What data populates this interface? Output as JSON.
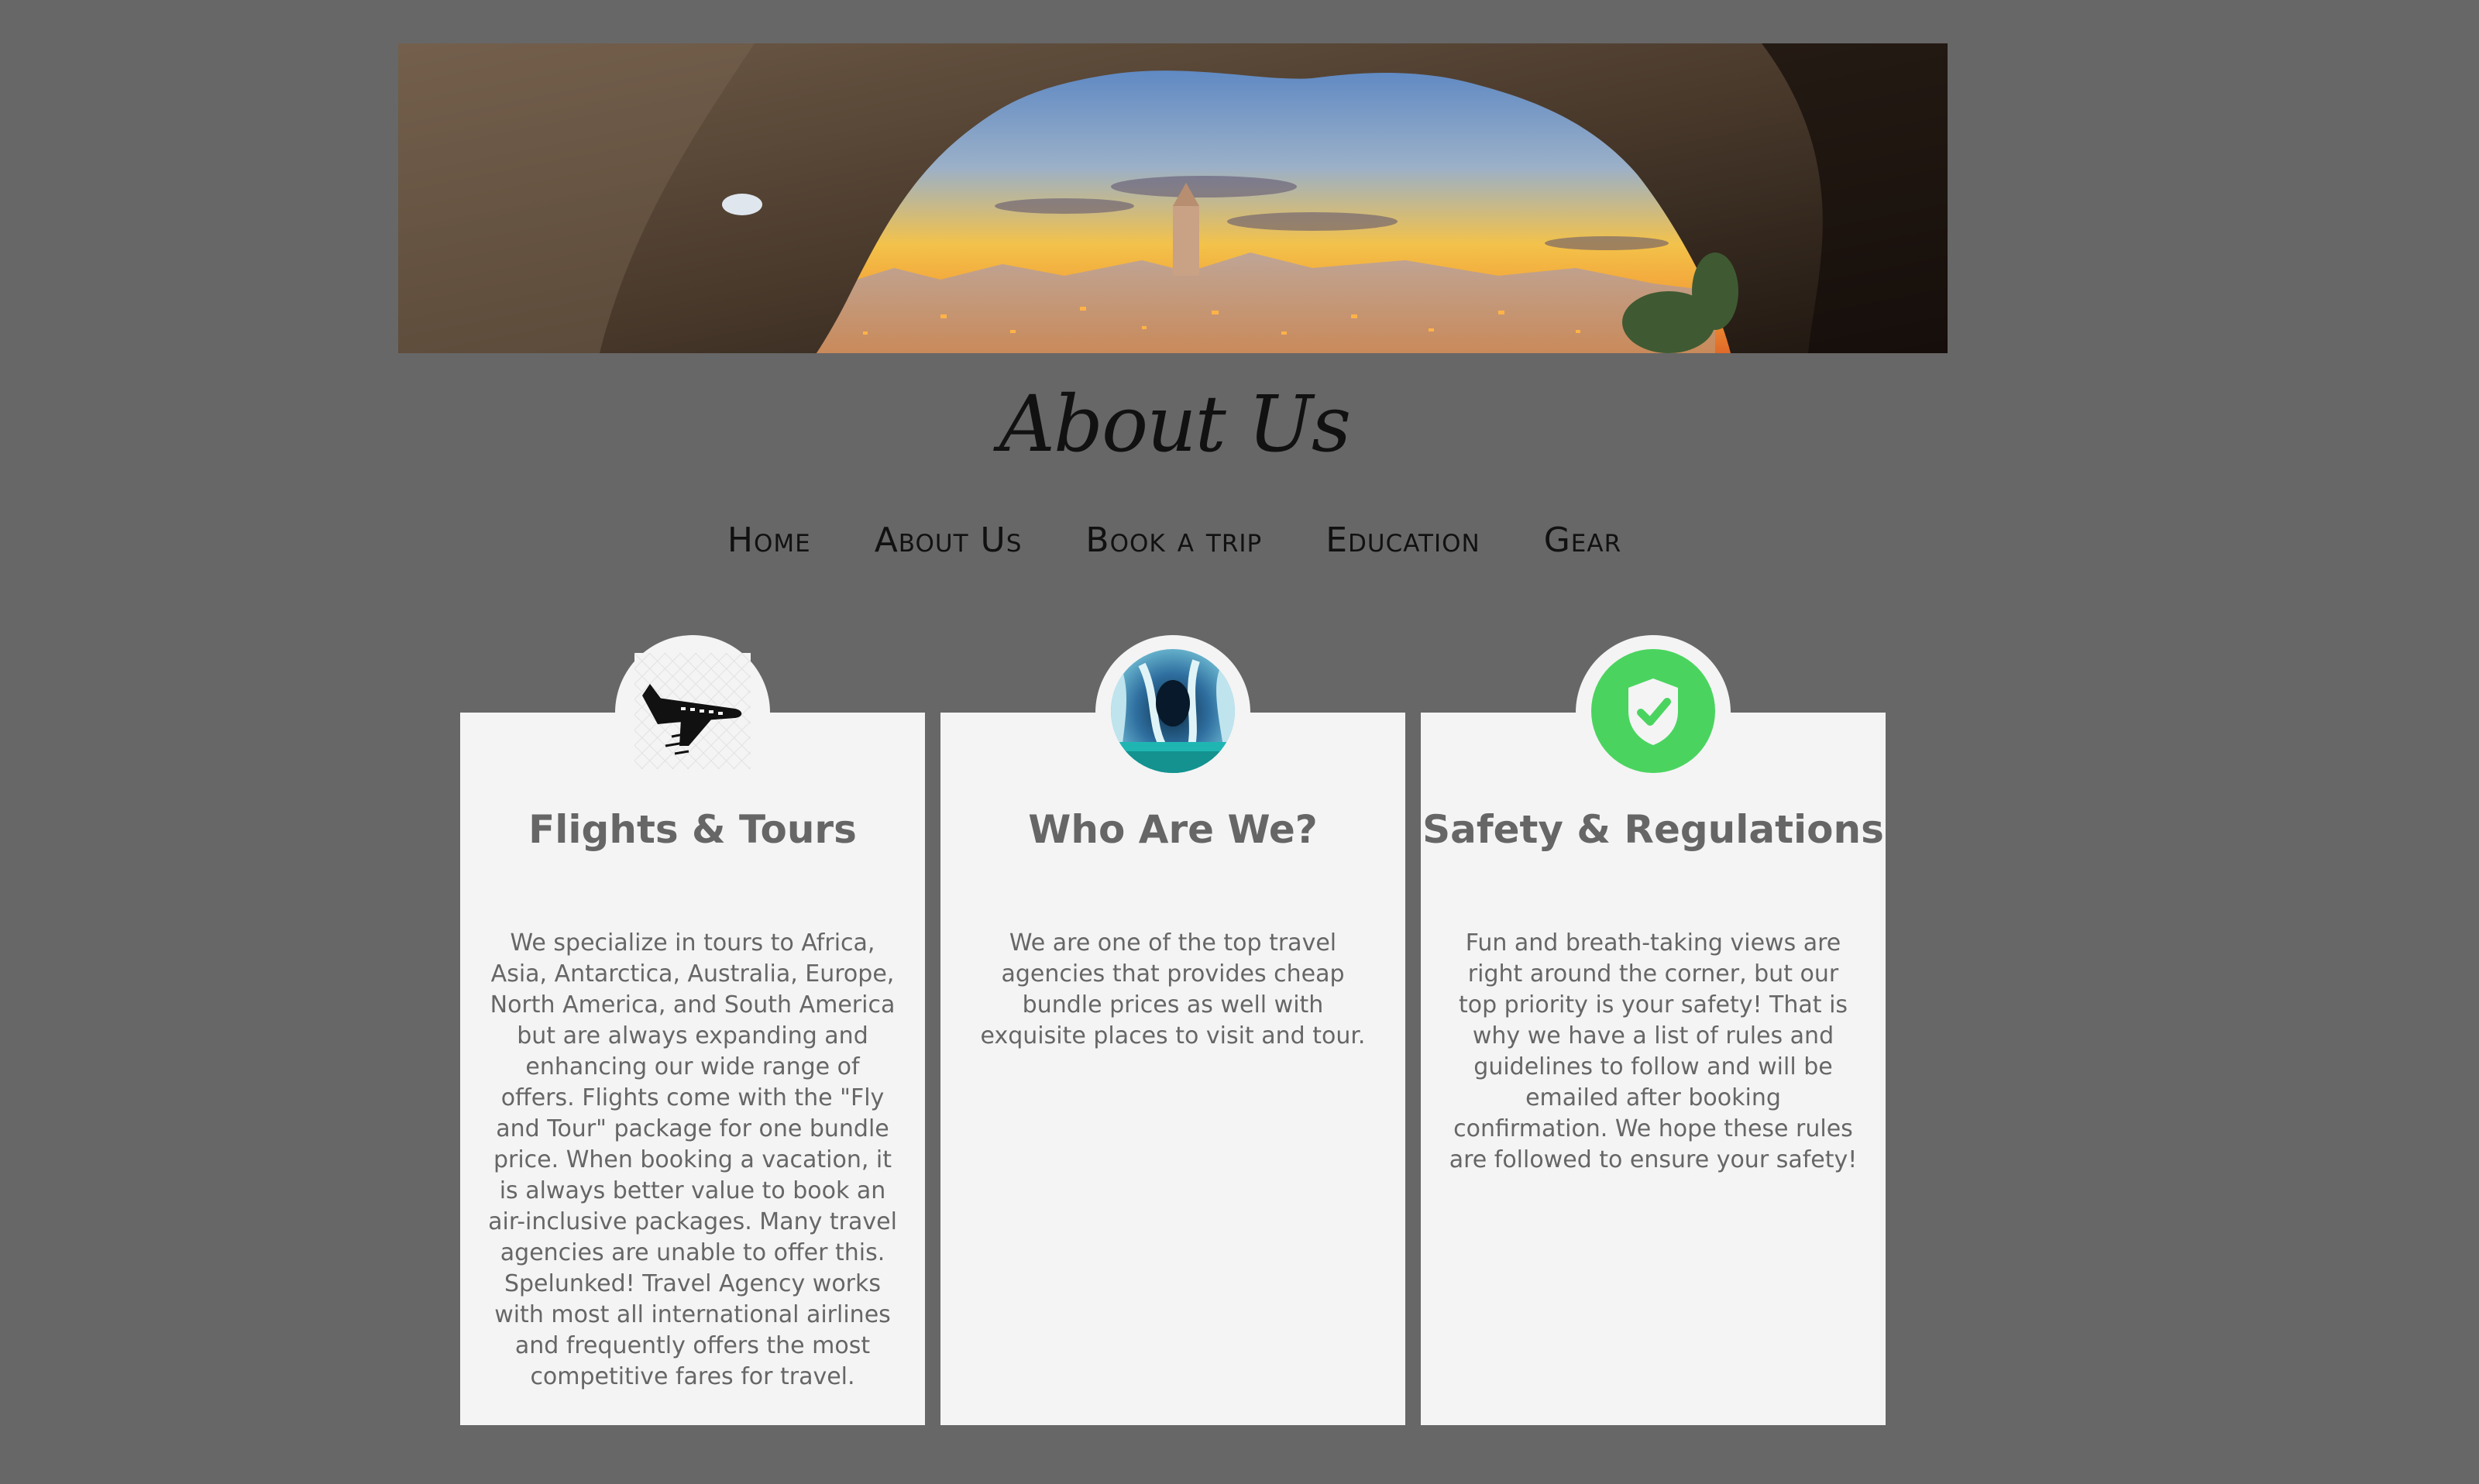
{
  "header": {
    "title": "About Us",
    "hero_icon": "cave-sunset-image"
  },
  "nav": {
    "items": [
      {
        "label": "Home"
      },
      {
        "label": "About Us"
      },
      {
        "label": "Book a trip"
      },
      {
        "label": "Education"
      },
      {
        "label": "Gear"
      }
    ]
  },
  "cards": [
    {
      "icon": "airplane-icon",
      "title": "Flights & Tours",
      "text": "We specialize in tours to Africa, Asia, Antarctica, Australia, Europe, North America, and South America but are always expanding and enhancing our wide range of offers. Flights come with the \"Fly and Tour\" package for one bundle price. When booking a vacation, it is always better value to book an air-inclusive packages. Many travel agencies are unable to offer this. Spelunked! Travel Agency works with most all international airlines and frequently offers the most competitive fares for travel."
    },
    {
      "icon": "marble-cave-image",
      "title": "Who Are We?",
      "text": "We are one of the top travel agencies that provides cheap bundle prices as well with exquisite places to visit and tour."
    },
    {
      "icon": "shield-check-icon",
      "title": "Safety & Regulations",
      "text": "Fun and breath-taking views are right around the corner, but our top priority is your safety! That is why we have a list of rules and guidelines to follow and will be emailed after booking confirmation. We hope these rules are followed to ensure your safety!"
    }
  ],
  "colors": {
    "background": "#676767",
    "card": "#f4f4f4",
    "text": "#666666",
    "shield_green": "#4ad45f"
  }
}
